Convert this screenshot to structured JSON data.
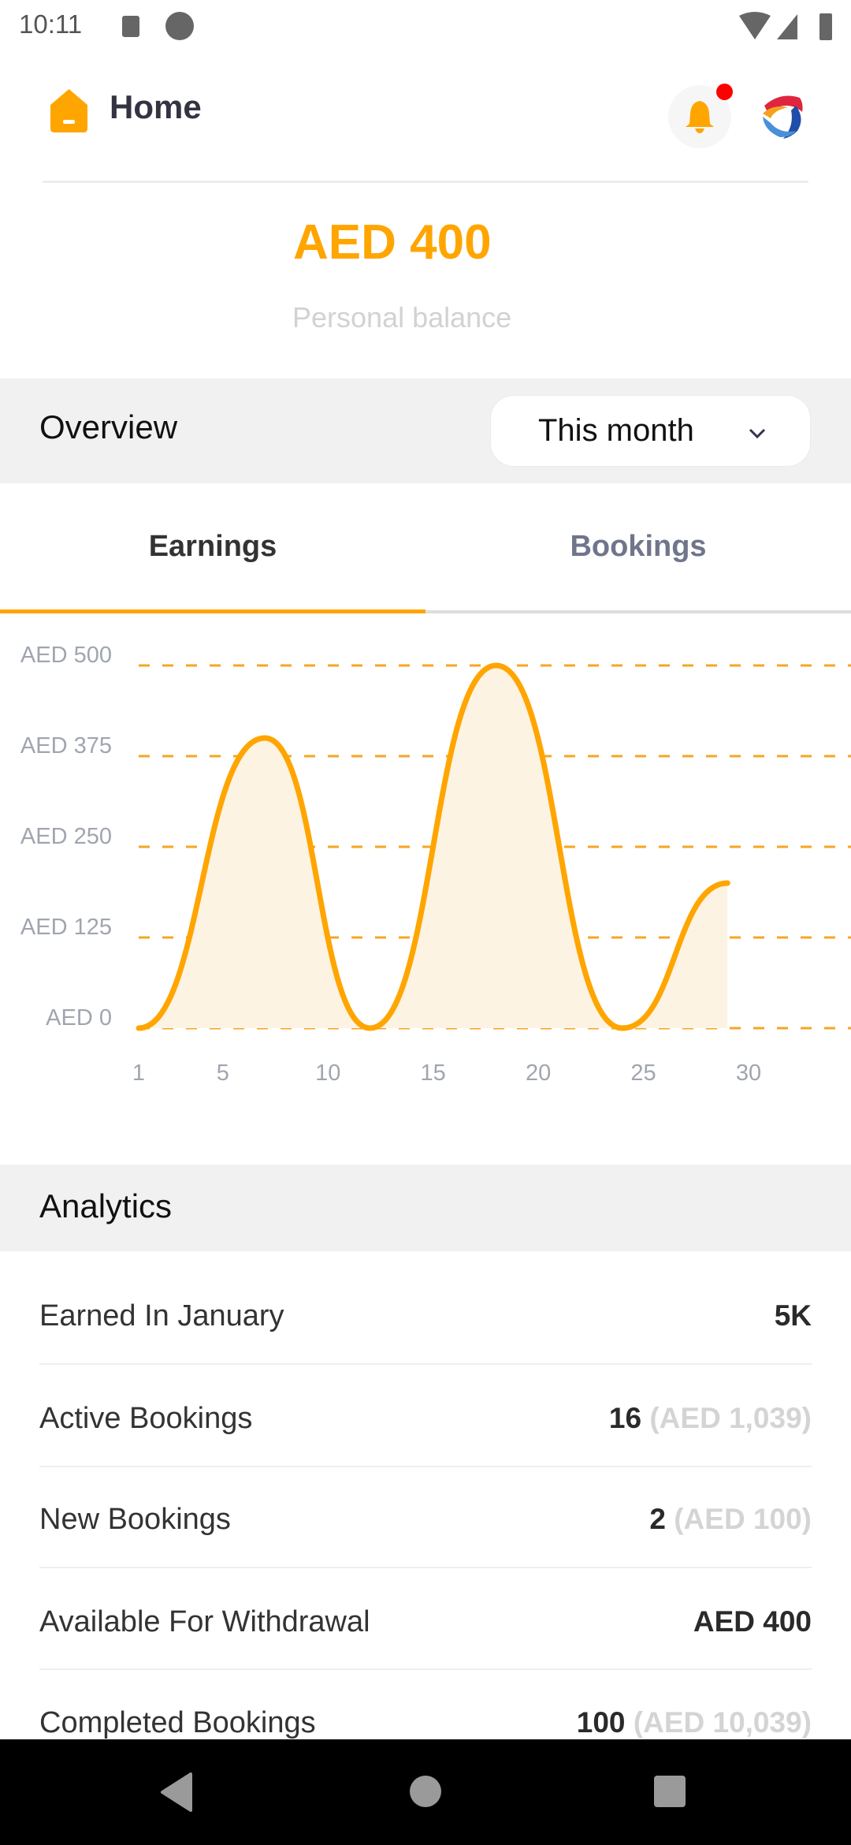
{
  "status_bar": {
    "time": "10:11"
  },
  "header": {
    "title": "Home",
    "has_notification": true
  },
  "balance": {
    "amount": "AED 400",
    "label": "Personal balance"
  },
  "overview": {
    "title": "Overview",
    "period": "This month"
  },
  "tabs": [
    {
      "label": "Earnings",
      "active": true
    },
    {
      "label": "Bookings",
      "active": false
    }
  ],
  "colors": {
    "accent": "#FFA500",
    "fill": "#FDF3E3",
    "notification": "#FF0000"
  },
  "chart_data": {
    "type": "area",
    "x_ticks": [
      "1",
      "5",
      "10",
      "15",
      "20",
      "25",
      "30"
    ],
    "y_ticks": [
      "AED 0",
      "AED 125",
      "AED 250",
      "AED 375",
      "AED 500"
    ],
    "ylim": [
      0,
      500
    ],
    "xlim": [
      1,
      30
    ],
    "grid": "dashed horizontal",
    "points": [
      [
        1,
        0
      ],
      [
        7,
        400
      ],
      [
        12,
        0
      ],
      [
        18,
        500
      ],
      [
        24,
        0
      ],
      [
        29,
        200
      ]
    ]
  },
  "analytics": {
    "title": "Analytics",
    "rows": [
      {
        "label": "Earned In January",
        "value": "5K",
        "sub": ""
      },
      {
        "label": "Active Bookings",
        "value": "16",
        "sub": "(AED 1,039)"
      },
      {
        "label": "New Bookings",
        "value": "2",
        "sub": "(AED 100)"
      },
      {
        "label": "Available For Withdrawal",
        "value": "AED 400",
        "sub": ""
      },
      {
        "label": "Completed Bookings",
        "value": "100",
        "sub": "(AED 10,039)"
      }
    ]
  }
}
